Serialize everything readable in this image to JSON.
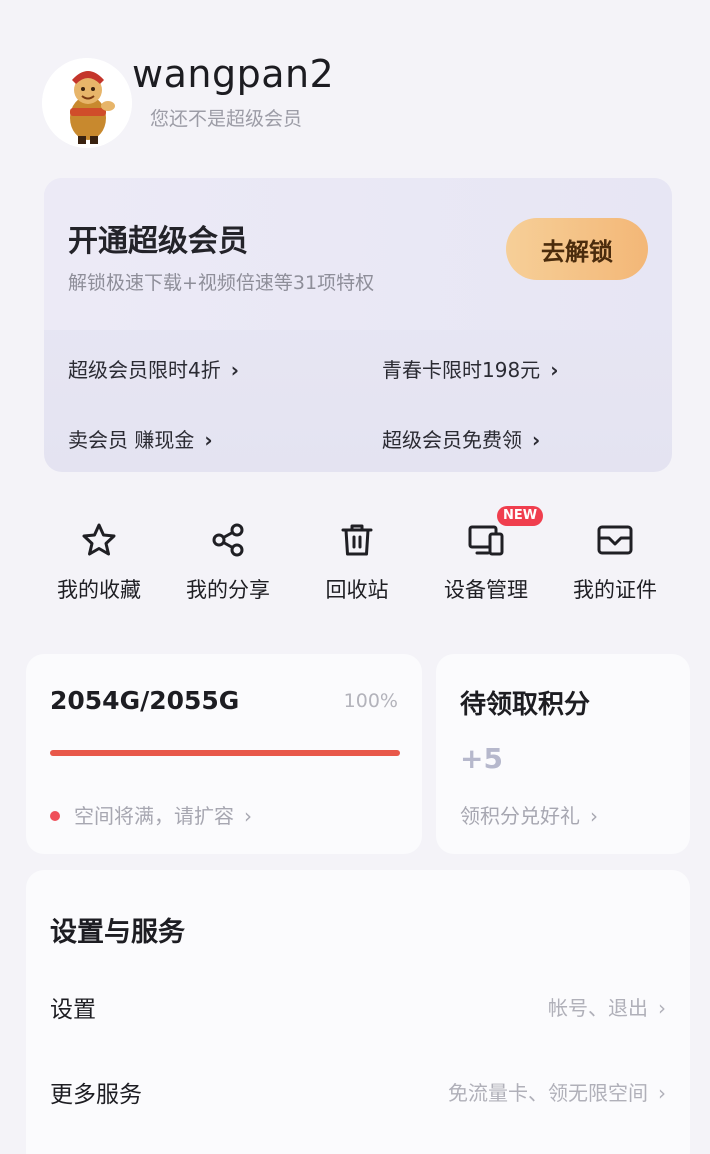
{
  "profile": {
    "username": "wangpan2",
    "member_status": "您还不是超级会员"
  },
  "vip": {
    "title": "开通超级会员",
    "subtitle": "解锁极速下载+视频倍速等31项特权",
    "unlock_button": "去解锁",
    "links": [
      "超级会员限时4折",
      "青春卡限时198元",
      "卖会员 赚现金",
      "超级会员免费领"
    ]
  },
  "quick_actions": [
    {
      "label": "我的收藏",
      "icon": "star-icon"
    },
    {
      "label": "我的分享",
      "icon": "share-icon"
    },
    {
      "label": "回收站",
      "icon": "trash-icon"
    },
    {
      "label": "设备管理",
      "icon": "devices-icon",
      "badge": "NEW"
    },
    {
      "label": "我的证件",
      "icon": "id-card-icon"
    }
  ],
  "storage": {
    "used": "2054G/2055G",
    "percent": "100%",
    "fill_fraction": 1.0,
    "warning": "空间将满，请扩容"
  },
  "points": {
    "title": "待领取积分",
    "value": "+5",
    "link": "领积分兑好礼"
  },
  "settings": {
    "title": "设置与服务",
    "rows": [
      {
        "label": "设置",
        "hint": "帐号、退出"
      },
      {
        "label": "更多服务",
        "hint": "免流量卡、领无限空间"
      }
    ]
  },
  "colors": {
    "accent_gold": "#f3b777",
    "progress_red": "#e8584a",
    "badge_red": "#f03e4e"
  }
}
